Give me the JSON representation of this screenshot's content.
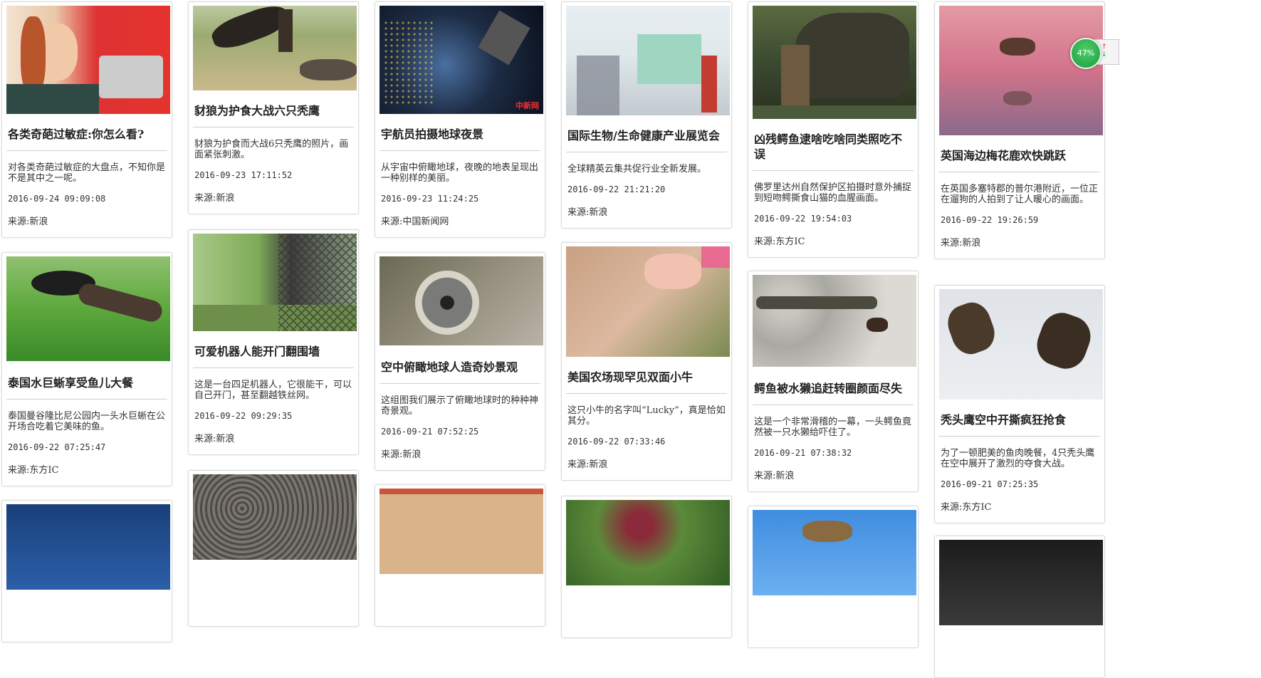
{
  "widget": {
    "percent": "47%"
  },
  "cards": {
    "c1": {
      "title": "各类奇葩过敏症:你怎么看?",
      "desc": "对各类奇葩过敏症的大盘点，不知你是不是其中之一呢。",
      "date": "2016-09-24 09:09:08",
      "source": "来源:新浪"
    },
    "c2": {
      "title": "泰国水巨蜥享受鱼儿大餐",
      "desc": "泰国曼谷隆比尼公园内一头水巨蜥在公开场合吃着它美味的鱼。",
      "date": "2016-09-22 07:25:47",
      "source": "来源:东方IC"
    },
    "c3": {
      "title": "豺狼为护食大战六只秃鹰",
      "desc": "豺狼为护食而大战6只秃鹰的照片，画面紧张刺激。",
      "date": "2016-09-23 17:11:52",
      "source": "来源:新浪"
    },
    "c4": {
      "title": "可爱机器人能开门翻围墙",
      "desc": "这是一台四足机器人，它很能干，可以自己开门，甚至翻越铁丝网。",
      "date": "2016-09-22 09:29:35",
      "source": "来源:新浪"
    },
    "c5": {
      "title": "宇航员拍摄地球夜景",
      "desc": "从宇宙中俯瞰地球，夜晚的地表呈现出一种别样的美丽。",
      "date": "2016-09-23 11:24:25",
      "source": "来源:中国新闻网",
      "watermark": "中新网"
    },
    "c6": {
      "title": "空中俯瞰地球人造奇妙景观",
      "desc": "这组图我们展示了俯瞰地球时的种种神奇景观。",
      "date": "2016-09-21 07:52:25",
      "source": "来源:新浪"
    },
    "c7": {
      "title": "国际生物/生命健康产业展览会",
      "desc": "全球精英云集共促行业全新发展。",
      "date": "2016-09-22 21:21:20",
      "source": "来源:新浪"
    },
    "c8": {
      "title": "美国农场现罕见双面小牛",
      "desc": "这只小牛的名字叫“Lucky”，真是恰如其分。",
      "date": "2016-09-22 07:33:46",
      "source": "来源:新浪"
    },
    "c9": {
      "title": "凶残鳄鱼逮啥吃啥同类照吃不误",
      "desc": "佛罗里达州自然保护区拍摄时意外捕捉到短吻鳄撕食山猫的血腥画面。",
      "date": "2016-09-22 19:54:03",
      "source": "来源:东方IC"
    },
    "c10": {
      "title": "鳄鱼被水獭追赶转圈颜面尽失",
      "desc": "这是一个非常滑稽的一幕，一头鳄鱼竟然被一只水獭给吓住了。",
      "date": "2016-09-21 07:38:32",
      "source": "来源:新浪"
    },
    "c11": {
      "title": "英国海边梅花鹿欢快跳跃",
      "desc": "在英国多塞特郡的普尔港附近，一位正在遛狗的人拍到了让人暖心的画面。",
      "date": "2016-09-22 19:26:59",
      "source": "来源:新浪"
    },
    "c12": {
      "title": "秃头鹰空中开撕疯狂抢食",
      "desc": "为了一顿肥美的鱼肉晚餐，4只秃头鹰在空中展开了激烈的夺食大战。",
      "date": "2016-09-21 07:25:35",
      "source": "来源:东方IC"
    }
  }
}
